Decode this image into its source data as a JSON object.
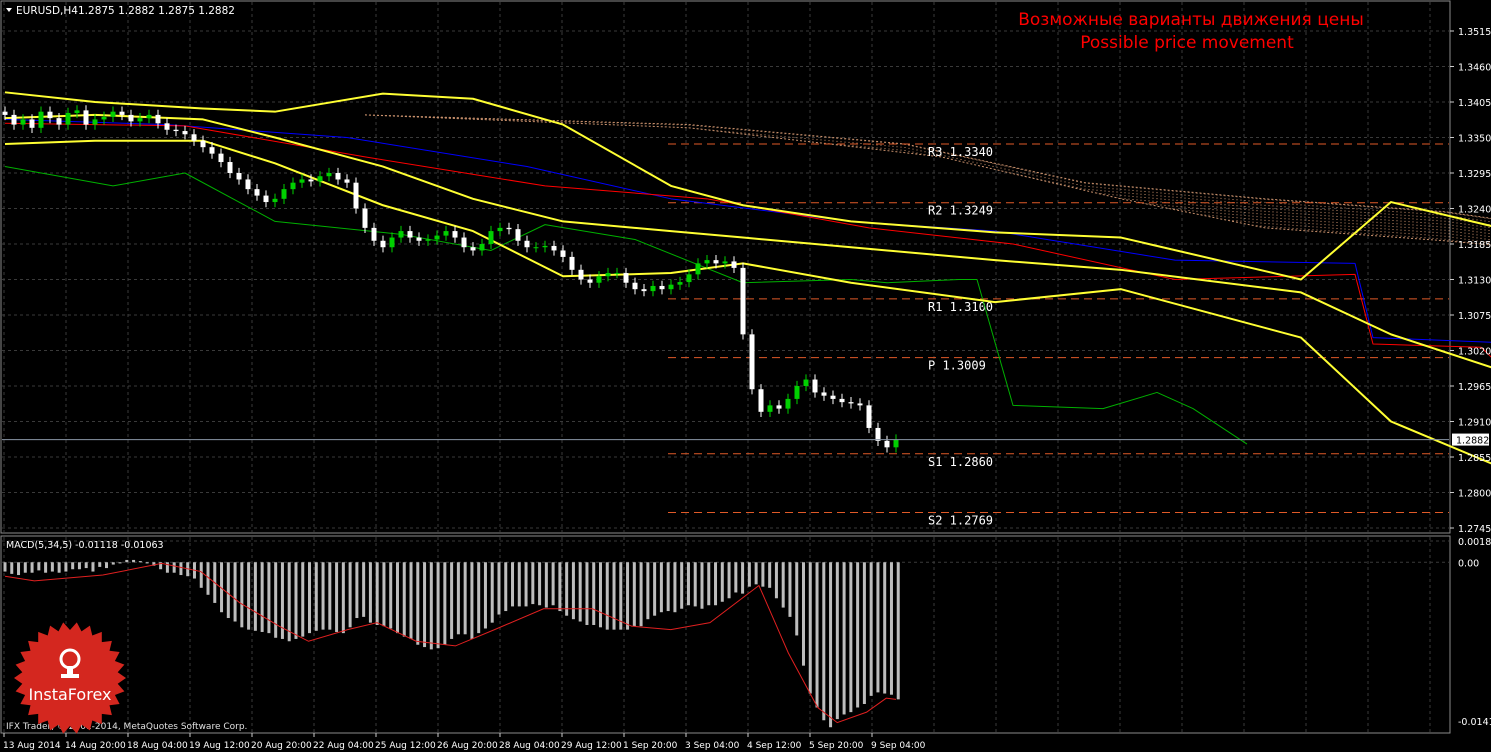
{
  "header": {
    "symbol": "EURUSD,H4",
    "ohlc": "1.2875 1.2882 1.2875 1.2882",
    "annotation_ru": "Возможные варианты движения цены",
    "annotation_en": "Possible price movement"
  },
  "macd": {
    "label": "MACD(5,34,5) -0.01118 -0.01063",
    "ticks": [
      "0.00183",
      "0.00",
      "-0.01418"
    ]
  },
  "footer": {
    "copyright": "IFX Trader, © 2001-2014, MetaQuotes Software Corp."
  },
  "logo": {
    "text": "InstaForex"
  },
  "colors": {
    "background": "#000000",
    "grid": "#3a3a3a",
    "bull": "#00d000",
    "bear": "#ffffff",
    "bands": "#ffff33",
    "kijun": "#0000ff",
    "tenkan": "#ff0000",
    "chikou": "#00b000",
    "kumo": "#c8906c",
    "levels": "#e05a28",
    "forecast": "#1e1eff",
    "annotation": "#ff0000",
    "macd_hist": "#bdbdbd",
    "macd_signal": "#e02020",
    "logo": "#d4271f"
  },
  "chart_data": {
    "type": "candlestick",
    "symbol": "EURUSD",
    "timeframe": "H4",
    "ylim": [
      1.2725,
      1.3535
    ],
    "y_ticks": [
      1.3515,
      1.346,
      1.3405,
      1.335,
      1.3295,
      1.324,
      1.3185,
      1.313,
      1.3075,
      1.302,
      1.2965,
      1.291,
      1.2855,
      1.28,
      1.2745
    ],
    "current_price": 1.2882,
    "x_labels": [
      "13 Aug 2014",
      "14 Aug 20:00",
      "18 Aug 04:00",
      "19 Aug 12:00",
      "20 Aug 20:00",
      "22 Aug 04:00",
      "25 Aug 12:00",
      "26 Aug 20:00",
      "28 Aug 04:00",
      "29 Aug 12:00",
      "1 Sep 20:00",
      "3 Sep 04:00",
      "4 Sep 12:00",
      "5 Sep 20:00",
      "9 Sep 04:00"
    ],
    "levels": [
      {
        "label": "R3",
        "value": "1.3340"
      },
      {
        "label": "R2",
        "value": "1.3249"
      },
      {
        "label": "R1",
        "value": "1.3100"
      },
      {
        "label": "P",
        "value": "1.3009"
      },
      {
        "label": "S1",
        "value": "1.2860"
      },
      {
        "label": "S2",
        "value": "1.2769"
      }
    ],
    "candles_close": [
      1.3385,
      1.337,
      1.3378,
      1.3365,
      1.339,
      1.338,
      1.337,
      1.3388,
      1.3392,
      1.337,
      1.3378,
      1.3382,
      1.339,
      1.3385,
      1.3375,
      1.338,
      1.3385,
      1.3372,
      1.3362,
      1.336,
      1.3355,
      1.3345,
      1.3335,
      1.3325,
      1.3312,
      1.3295,
      1.3285,
      1.327,
      1.326,
      1.325,
      1.3255,
      1.327,
      1.328,
      1.3285,
      1.3282,
      1.329,
      1.3295,
      1.3285,
      1.328,
      1.324,
      1.321,
      1.319,
      1.318,
      1.3195,
      1.3205,
      1.3195,
      1.319,
      1.3192,
      1.3198,
      1.3205,
      1.3195,
      1.318,
      1.3175,
      1.3185,
      1.3205,
      1.321,
      1.3208,
      1.319,
      1.318,
      1.318,
      1.3182,
      1.3175,
      1.3165,
      1.3145,
      1.313,
      1.3125,
      1.3135,
      1.314,
      1.314,
      1.3125,
      1.3115,
      1.3112,
      1.312,
      1.3115,
      1.3122,
      1.3126,
      1.3138,
      1.3155,
      1.316,
      1.3155,
      1.3158,
      1.3148,
      1.3045,
      1.296,
      1.2925,
      1.2935,
      1.293,
      1.2945,
      1.2965,
      1.2975,
      1.2955,
      1.295,
      1.2945,
      1.294,
      1.2938,
      1.2935,
      1.29,
      1.288,
      1.287,
      1.2882
    ],
    "bollinger": {
      "upper": [
        [
          1.342,
          0
        ],
        [
          1.3405,
          10
        ],
        [
          1.3395,
          22
        ],
        [
          1.339,
          30
        ],
        [
          1.3418,
          42
        ],
        [
          1.341,
          52
        ],
        [
          1.337,
          62
        ],
        [
          1.3275,
          74
        ],
        [
          1.3245,
          82
        ],
        [
          1.322,
          94
        ],
        [
          1.3203,
          110
        ],
        [
          1.3195,
          124
        ],
        [
          1.313,
          144
        ],
        [
          1.325,
          154
        ],
        [
          1.321,
          166
        ],
        [
          1.3095,
          178
        ]
      ],
      "middle": [
        [
          1.338,
          0
        ],
        [
          1.3385,
          10
        ],
        [
          1.3378,
          22
        ],
        [
          1.335,
          30
        ],
        [
          1.3305,
          42
        ],
        [
          1.3255,
          52
        ],
        [
          1.322,
          62
        ],
        [
          1.3205,
          74
        ],
        [
          1.3195,
          82
        ],
        [
          1.318,
          94
        ],
        [
          1.316,
          110
        ],
        [
          1.3145,
          124
        ],
        [
          1.311,
          144
        ],
        [
          1.3045,
          154
        ],
        [
          1.299,
          166
        ],
        [
          1.2955,
          178
        ]
      ],
      "lower": [
        [
          1.334,
          0
        ],
        [
          1.3345,
          10
        ],
        [
          1.3345,
          22
        ],
        [
          1.331,
          30
        ],
        [
          1.3245,
          42
        ],
        [
          1.3205,
          52
        ],
        [
          1.3135,
          62
        ],
        [
          1.314,
          74
        ],
        [
          1.3155,
          82
        ],
        [
          1.3125,
          94
        ],
        [
          1.3095,
          110
        ],
        [
          1.3115,
          124
        ],
        [
          1.304,
          144
        ],
        [
          1.291,
          154
        ],
        [
          1.284,
          166
        ],
        [
          1.2815,
          178
        ]
      ]
    },
    "ichimoku": {
      "kijun": [
        [
          1.3378,
          0
        ],
        [
          1.337,
          18
        ],
        [
          1.335,
          38
        ],
        [
          1.3305,
          58
        ],
        [
          1.3255,
          74
        ],
        [
          1.322,
          94
        ],
        [
          1.3205,
          110
        ],
        [
          1.316,
          130
        ],
        [
          1.3155,
          150
        ],
        [
          1.304,
          152
        ],
        [
          1.303,
          170
        ],
        [
          1.301,
          178
        ]
      ],
      "tenkan": [
        [
          1.3372,
          0
        ],
        [
          1.3368,
          20
        ],
        [
          1.332,
          40
        ],
        [
          1.3275,
          60
        ],
        [
          1.3255,
          78
        ],
        [
          1.321,
          96
        ],
        [
          1.3185,
          112
        ],
        [
          1.313,
          130
        ],
        [
          1.3138,
          150
        ],
        [
          1.303,
          152
        ],
        [
          1.3025,
          164
        ],
        [
          1.2945,
          170
        ],
        [
          1.2915,
          178
        ]
      ],
      "chikou": [
        [
          1.3305,
          0
        ],
        [
          1.3275,
          12
        ],
        [
          1.3295,
          20
        ],
        [
          1.322,
          30
        ],
        [
          1.32,
          44
        ],
        [
          1.3175,
          54
        ],
        [
          1.3215,
          60
        ],
        [
          1.3192,
          70
        ],
        [
          1.3125,
          82
        ],
        [
          1.313,
          94
        ],
        [
          1.3125,
          98
        ],
        [
          1.313,
          106
        ],
        [
          1.313,
          108
        ],
        [
          1.2935,
          112
        ],
        [
          1.293,
          122
        ],
        [
          1.2955,
          128
        ],
        [
          1.293,
          132
        ],
        [
          1.2875,
          138
        ]
      ],
      "kumo_top": [
        [
          1.3385,
          40
        ],
        [
          1.337,
          76
        ],
        [
          1.334,
          100
        ],
        [
          1.328,
          120
        ],
        [
          1.3255,
          140
        ],
        [
          1.3235,
          160
        ],
        [
          1.3195,
          180
        ],
        [
          1.3185,
          196
        ],
        [
          1.307,
          210
        ],
        [
          1.305,
          222
        ]
      ],
      "kumo_bottom": [
        [
          1.3385,
          40
        ],
        [
          1.3365,
          76
        ],
        [
          1.332,
          104
        ],
        [
          1.3255,
          124
        ],
        [
          1.321,
          140
        ],
        [
          1.319,
          160
        ],
        [
          1.3165,
          180
        ],
        [
          1.3125,
          196
        ],
        [
          1.303,
          206
        ],
        [
          1.296,
          222
        ]
      ]
    },
    "forecast_paths": [
      [
        [
          1.2878,
          183
        ],
        [
          1.2918,
          192
        ]
      ],
      [
        [
          1.2878,
          183
        ],
        [
          1.2768,
          197
        ],
        [
          1.2823,
          205
        ]
      ]
    ],
    "macd": {
      "ylim": [
        -0.01418,
        0.00183
      ],
      "histogram": [
        -0.0008,
        -0.001,
        -0.0011,
        -0.0009,
        -0.0009,
        -0.0007,
        -0.0009,
        -0.0008,
        -0.0009,
        -0.0008,
        -0.0006,
        -0.0006,
        -0.0005,
        -0.0008,
        -0.0004,
        -0.0005,
        -0.0002,
        -0.0001,
        0.0002,
        0.0002,
        0.0001,
        -0.0001,
        -0.0003,
        -0.0006,
        -0.0009,
        -0.0009,
        -0.0011,
        -0.0012,
        -0.0014,
        -0.0022,
        -0.0028,
        -0.0035,
        -0.0043,
        -0.0048,
        -0.0051,
        -0.0056,
        -0.0058,
        -0.0059,
        -0.006,
        -0.0061,
        -0.0065,
        -0.0066,
        -0.0068,
        -0.0066,
        -0.0064,
        -0.0061,
        -0.0059,
        -0.0058,
        -0.0058,
        -0.006,
        -0.0061,
        -0.0056,
        -0.0048,
        -0.0047,
        -0.0052,
        -0.0054,
        -0.0055,
        -0.0057,
        -0.0061,
        -0.0064,
        -0.0066,
        -0.0071,
        -0.0073,
        -0.0075,
        -0.0074,
        -0.0071,
        -0.0066,
        -0.0062,
        -0.0062,
        -0.0066,
        -0.0061,
        -0.0057,
        -0.0052,
        -0.0045,
        -0.0042,
        -0.0038,
        -0.0038,
        -0.0038,
        -0.0036,
        -0.0037,
        -0.0039,
        -0.0037,
        -0.0042,
        -0.0046,
        -0.0049,
        -0.0051,
        -0.0054,
        -0.0054,
        -0.0056,
        -0.0058,
        -0.0058,
        -0.0058,
        -0.0058,
        -0.0055,
        -0.0055,
        -0.0049,
        -0.0046,
        -0.0043,
        -0.0042,
        -0.0043,
        -0.004,
        -0.0037,
        -0.0038,
        -0.004,
        -0.0037,
        -0.0037,
        -0.0034,
        -0.0031,
        -0.0026,
        -0.0027,
        -0.0021,
        -0.0019,
        -0.0021,
        -0.0022,
        -0.0031,
        -0.0039,
        -0.0047,
        -0.0063,
        -0.0089,
        -0.0113,
        -0.0125,
        -0.0136,
        -0.0142,
        -0.0135,
        -0.0131,
        -0.0129,
        -0.0125,
        -0.0122,
        -0.0115,
        -0.0112,
        -0.0113,
        -0.0114,
        -0.0118
      ],
      "signal": [
        [
          -0.0012,
          0
        ],
        [
          -0.0016,
          6
        ],
        [
          -0.0011,
          20
        ],
        [
          -0.0001,
          32
        ],
        [
          -0.0008,
          40
        ],
        [
          -0.0035,
          48
        ],
        [
          -0.0055,
          56
        ],
        [
          -0.0068,
          62
        ],
        [
          -0.0058,
          70
        ],
        [
          -0.0052,
          76
        ],
        [
          -0.0068,
          84
        ],
        [
          -0.0072,
          92
        ],
        [
          -0.0058,
          100
        ],
        [
          -0.004,
          110
        ],
        [
          -0.004,
          120
        ],
        [
          -0.0055,
          128
        ],
        [
          -0.0058,
          136
        ],
        [
          -0.0052,
          144
        ],
        [
          -0.002,
          154
        ],
        [
          -0.0078,
          160
        ],
        [
          -0.0125,
          166
        ],
        [
          -0.0138,
          170
        ],
        [
          -0.0129,
          176
        ],
        [
          -0.0117,
          180
        ],
        [
          -0.0118,
          182
        ]
      ]
    }
  }
}
